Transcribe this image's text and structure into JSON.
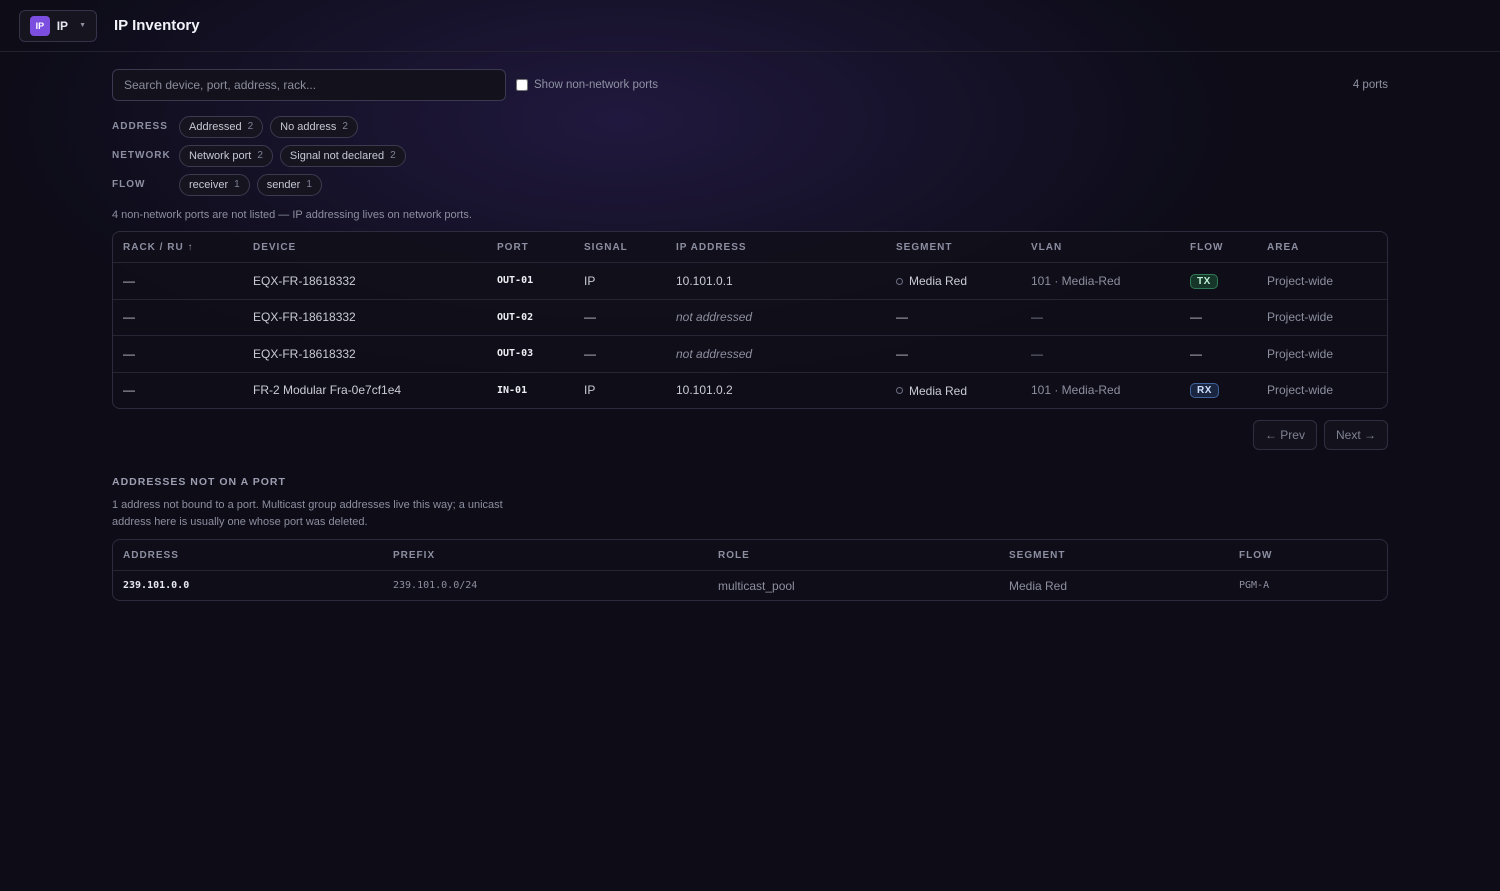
{
  "header": {
    "app_badge": "IP",
    "app_name": "IP",
    "page_title": "IP Inventory"
  },
  "search": {
    "placeholder": "Search device, port, address, rack...",
    "show_non_network_label": "Show non-network ports",
    "count": "4 ports"
  },
  "filters": [
    {
      "label": "ADDRESS",
      "chips": [
        {
          "text": "Addressed",
          "count": "2"
        },
        {
          "text": "No address",
          "count": "2"
        }
      ]
    },
    {
      "label": "NETWORK",
      "chips": [
        {
          "text": "Network port",
          "count": "2"
        },
        {
          "text": "Signal not declared",
          "count": "2"
        }
      ]
    },
    {
      "label": "FLOW",
      "chips": [
        {
          "text": "receiver",
          "count": "1"
        },
        {
          "text": "sender",
          "count": "1"
        }
      ]
    }
  ],
  "note": "4 non-network ports are not listed — IP addressing lives on network ports.",
  "ports_table": {
    "columns": [
      "RACK / RU ↑",
      "DEVICE",
      "PORT",
      "SIGNAL",
      "IP ADDRESS",
      "SEGMENT",
      "VLAN",
      "FLOW",
      "AREA"
    ],
    "rows": [
      {
        "rack": "—",
        "device": "EQX-FR-18618332",
        "port": "OUT-01",
        "signal": "IP",
        "ip": "10.101.0.1",
        "segment": "Media Red",
        "vlan": "101 · Media-Red",
        "flow": "TX",
        "area": "Project-wide"
      },
      {
        "rack": "—",
        "device": "EQX-FR-18618332",
        "port": "OUT-02",
        "signal": "—",
        "ip": "not addressed",
        "segment": "—",
        "vlan": "—",
        "flow": "—",
        "area": "Project-wide"
      },
      {
        "rack": "—",
        "device": "EQX-FR-18618332",
        "port": "OUT-03",
        "signal": "—",
        "ip": "not addressed",
        "segment": "—",
        "vlan": "—",
        "flow": "—",
        "area": "Project-wide"
      },
      {
        "rack": "—",
        "device": "FR-2 Modular Fra-0e7cf1e4",
        "port": "IN-01",
        "signal": "IP",
        "ip": "10.101.0.2",
        "segment": "Media Red",
        "vlan": "101 · Media-Red",
        "flow": "RX",
        "area": "Project-wide"
      }
    ]
  },
  "pager": {
    "prev": "← Prev",
    "next": "Next →"
  },
  "unbound": {
    "title": "ADDRESSES NOT ON A PORT",
    "description": "1 address not bound to a port. Multicast group addresses live this way; a unicast address here is usually one whose port was deleted.",
    "columns": [
      "ADDRESS",
      "PREFIX",
      "ROLE",
      "SEGMENT",
      "FLOW"
    ],
    "rows": [
      {
        "address": "239.101.0.0",
        "prefix": "239.101.0.0/24",
        "role": "multicast_pool",
        "segment": "Media Red",
        "flow": "PGM-A"
      }
    ]
  },
  "colors": {
    "accent": "#7c4ee0",
    "tx": "#2f7a56",
    "rx": "#40639e"
  }
}
